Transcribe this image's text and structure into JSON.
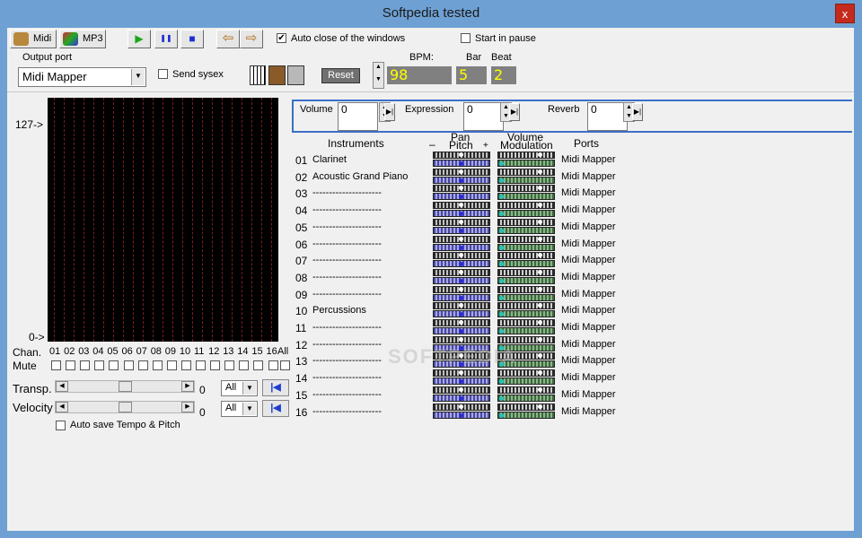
{
  "window": {
    "title": "Softpedia tested",
    "close_label": "x"
  },
  "tabs": [
    {
      "label": "Midi"
    },
    {
      "label": "MP3"
    }
  ],
  "transport": {
    "play": "▶",
    "pause": "❚❚",
    "stop": "■",
    "prev": "⇦",
    "next": "⇨"
  },
  "options": {
    "auto_close_label": "Auto close of the windows",
    "auto_close_checked": "✔",
    "start_pause_label": "Start in pause"
  },
  "output": {
    "label": "Output port",
    "value": "Midi Mapper",
    "send_sysex_label": "Send sysex"
  },
  "tempo": {
    "reset_label": "Reset",
    "bpm_label": "BPM:",
    "bpm_value": "98",
    "bar_label": "Bar",
    "bar_value": "5",
    "beat_label": "Beat",
    "beat_value": "2"
  },
  "grid": {
    "top_label": "127->",
    "bottom_label": "0->"
  },
  "controls": {
    "volume_label": "Volume",
    "volume_value": "0",
    "expression_label": "Expression",
    "expression_value": "0",
    "reverb_label": "Reverb",
    "reverb_value": "0"
  },
  "table": {
    "instruments_header": "Instruments",
    "pan_header": "Pan",
    "pitch_header": "Pitch",
    "minus": "–",
    "plus": "+",
    "volume_header": "Volume",
    "modulation_header": "Modulation",
    "ports_header": "Ports",
    "rows": [
      {
        "num": "01",
        "name": "Clarinet",
        "port": "Midi Mapper"
      },
      {
        "num": "02",
        "name": "Acoustic Grand Piano",
        "port": "Midi Mapper"
      },
      {
        "num": "03",
        "name": "---------------------",
        "port": "Midi Mapper"
      },
      {
        "num": "04",
        "name": "---------------------",
        "port": "Midi Mapper"
      },
      {
        "num": "05",
        "name": "---------------------",
        "port": "Midi Mapper"
      },
      {
        "num": "06",
        "name": "---------------------",
        "port": "Midi Mapper"
      },
      {
        "num": "07",
        "name": "---------------------",
        "port": "Midi Mapper"
      },
      {
        "num": "08",
        "name": "---------------------",
        "port": "Midi Mapper"
      },
      {
        "num": "09",
        "name": "---------------------",
        "port": "Midi Mapper"
      },
      {
        "num": "10",
        "name": "Percussions",
        "port": "Midi Mapper"
      },
      {
        "num": "11",
        "name": "---------------------",
        "port": "Midi Mapper"
      },
      {
        "num": "12",
        "name": "---------------------",
        "port": "Midi Mapper"
      },
      {
        "num": "13",
        "name": "---------------------",
        "port": "Midi Mapper"
      },
      {
        "num": "14",
        "name": "---------------------",
        "port": "Midi Mapper"
      },
      {
        "num": "15",
        "name": "---------------------",
        "port": "Midi Mapper"
      },
      {
        "num": "16",
        "name": "---------------------",
        "port": "Midi Mapper"
      }
    ]
  },
  "channels": {
    "chan_label": "Chan.",
    "mute_label": "Mute",
    "numbers": [
      "01",
      "02",
      "03",
      "04",
      "05",
      "06",
      "07",
      "08",
      "09",
      "10",
      "11",
      "12",
      "13",
      "14",
      "15",
      "16"
    ],
    "all_label": "All"
  },
  "transpose": {
    "label": "Transp.",
    "value": "0",
    "select": "All"
  },
  "velocity": {
    "label": "Velocity",
    "value": "0",
    "select": "All"
  },
  "auto_save_label": "Auto save Tempo & Pitch",
  "watermark": "SOFTPEDIA",
  "colors": {
    "window_frame": "#6ea0d4",
    "lcd_text": "#ffff00",
    "close": "#c42b1c",
    "accent_border": "#3b6fc9"
  }
}
